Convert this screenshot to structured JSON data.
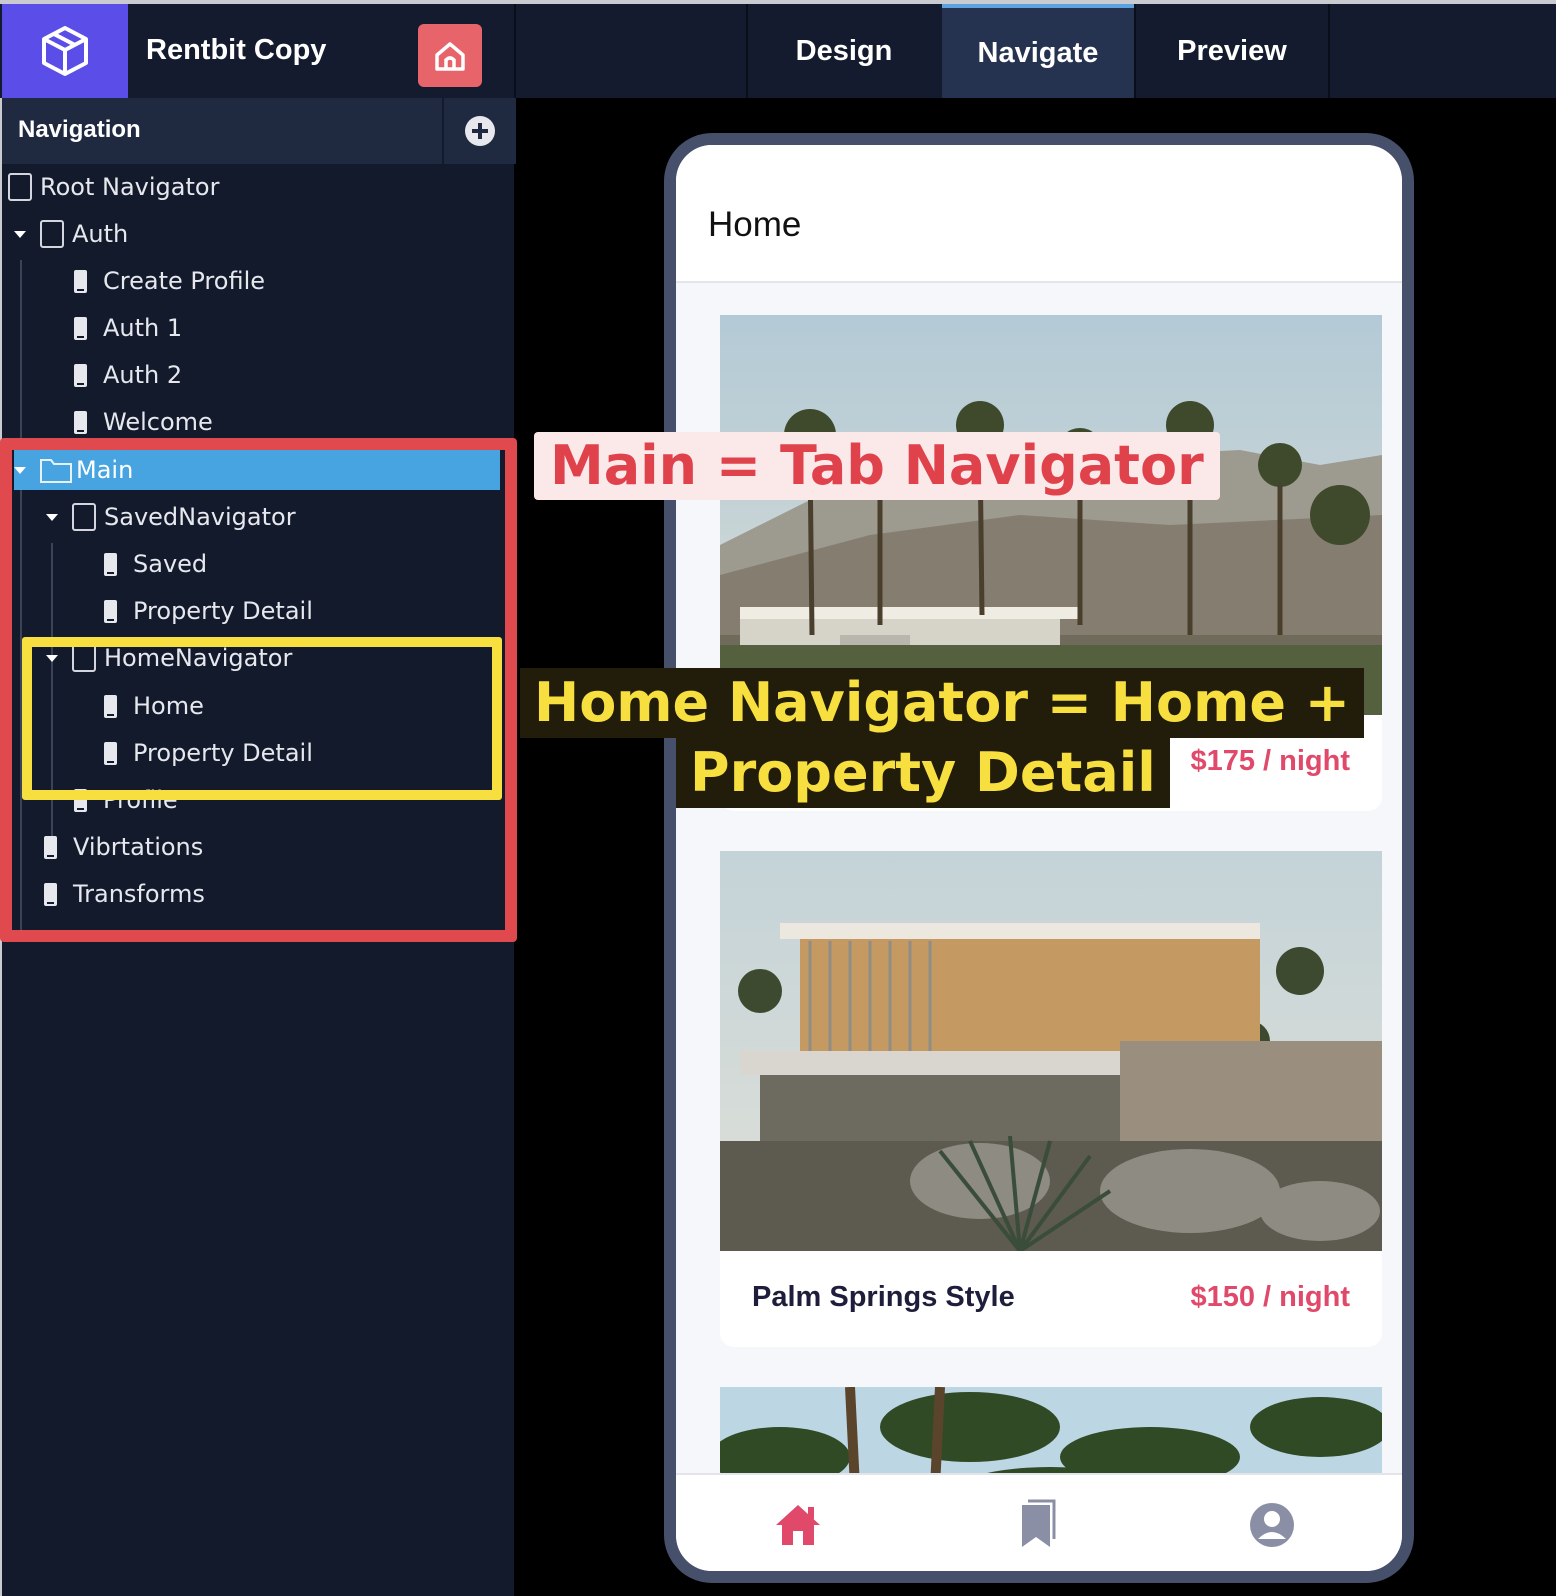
{
  "app": {
    "project_name": "Rentbit Copy",
    "logo_icon": "cube-icon",
    "home_icon": "home-icon"
  },
  "tabs": [
    {
      "label": "Design",
      "active": false
    },
    {
      "label": "Navigate",
      "active": true
    },
    {
      "label": "Preview",
      "active": false
    }
  ],
  "sidebar": {
    "title": "Navigation",
    "add_icon": "plus-circle-icon",
    "tree": {
      "root": "Root Navigator",
      "auth": "Auth",
      "auth_children": [
        "Create Profile",
        "Auth 1",
        "Auth 2",
        "Welcome"
      ],
      "main": "Main",
      "saved_nav": "SavedNavigator",
      "saved_children": [
        "Saved",
        "Property Detail"
      ],
      "home_nav": "HomeNavigator",
      "home_children": [
        "Home",
        "Property Detail"
      ],
      "profile": "Profile",
      "vibrations": "Vibrtations",
      "transforms": "Transforms"
    }
  },
  "annotations": {
    "main_label": "Main = Tab Navigator",
    "home_label_line1": "Home Navigator = Home +",
    "home_label_line2": "Property Detail",
    "red": "#e04a4f",
    "yellow": "#f7df3f"
  },
  "phone": {
    "title": "Home",
    "listings": [
      {
        "name": "",
        "price": "$175 / night"
      },
      {
        "name": "Palm Springs Style",
        "price": "$150 / night"
      }
    ],
    "tab_icons": [
      "home-icon",
      "bookmark-icon",
      "user-circle-icon"
    ],
    "accent": "#e0496a"
  }
}
